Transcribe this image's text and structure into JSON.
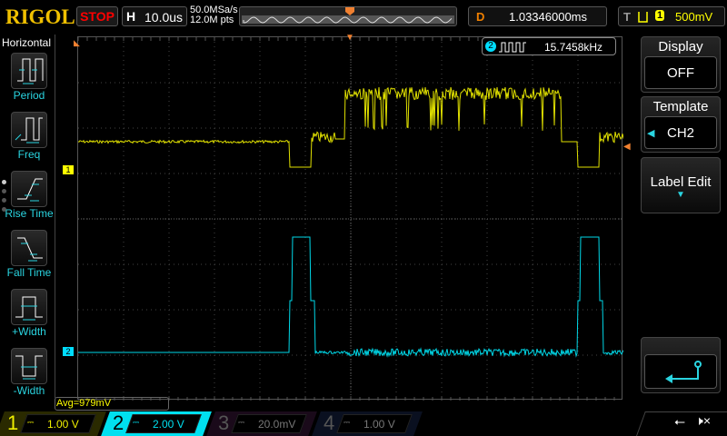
{
  "header": {
    "logo": "RIGOL",
    "run_state": "STOP",
    "horizontal_label": "H",
    "timebase": "10.0us",
    "sample_rate": "50.0MSa/s",
    "memory_depth": "12.0M pts",
    "delay_label": "D",
    "delay": "1.03346000ms",
    "trigger_label": "T",
    "trigger_source": "1",
    "trigger_level": "500mV"
  },
  "left_menu": {
    "title": "Horizontal",
    "items": [
      {
        "label": "Period",
        "icon": "period-icon"
      },
      {
        "label": "Freq",
        "icon": "freq-icon"
      },
      {
        "label": "Rise Time",
        "icon": "rise-time-icon"
      },
      {
        "label": "Fall Time",
        "icon": "fall-time-icon"
      },
      {
        "label": "+Width",
        "icon": "pos-width-icon"
      },
      {
        "label": "-Width",
        "icon": "neg-width-icon"
      }
    ]
  },
  "right_menu": {
    "display": {
      "title": "Display",
      "value": "OFF"
    },
    "template": {
      "title": "Template",
      "value": "CH2"
    },
    "label_edit": {
      "title": "Label Edit"
    }
  },
  "measurement": {
    "channel": "2",
    "value": "15.7458kHz",
    "avg": "Avg=979mV"
  },
  "markers": {
    "ch1": "1",
    "ch2": "2",
    "trigger": "T"
  },
  "channels": [
    {
      "num": "1",
      "coupling": "⎓",
      "scale": "1.00 V",
      "color": "#f0f000"
    },
    {
      "num": "2",
      "coupling": "⎓",
      "scale": "2.00 V",
      "color": "#00e0f0"
    },
    {
      "num": "3",
      "coupling": "⎓",
      "scale": "20.0mV",
      "color": "#a020a0"
    },
    {
      "num": "4",
      "coupling": "⎓",
      "scale": "1.00 V",
      "color": "#3070c0"
    }
  ],
  "status": {
    "usb": "usb-icon",
    "sound": "mute-icon"
  }
}
